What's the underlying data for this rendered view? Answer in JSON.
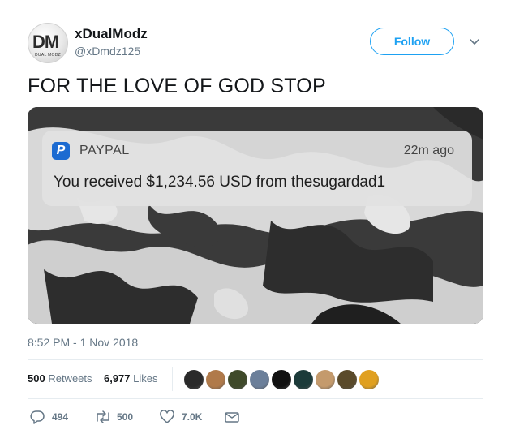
{
  "author": {
    "display_name": "xDualModz",
    "handle": "@xDmdz125",
    "avatar_logo": "DM",
    "avatar_subtext": "DUAL MODZ"
  },
  "follow_label": "Follow",
  "tweet_text": "FOR THE LOVE OF GOD STOP",
  "media": {
    "notification": {
      "app_name": "PAYPAL",
      "time": "22m ago",
      "message": "You received $1,234.56 USD from thesugardad1",
      "icon": "paypal-icon"
    }
  },
  "timestamp": "8:52 PM - 1 Nov 2018",
  "stats": {
    "retweets_count": "500",
    "retweets_label": "Retweets",
    "likes_count": "6,977",
    "likes_label": "Likes"
  },
  "likers": [
    "#2a2a2a",
    "#b07a4a",
    "#3f4a2a",
    "#6b7f9a",
    "#111111",
    "#1c3b3a",
    "#c49a6c",
    "#5a4a2a",
    "#e0a020"
  ],
  "actions": {
    "replies": "494",
    "retweets": "500",
    "likes": "7.0K"
  }
}
